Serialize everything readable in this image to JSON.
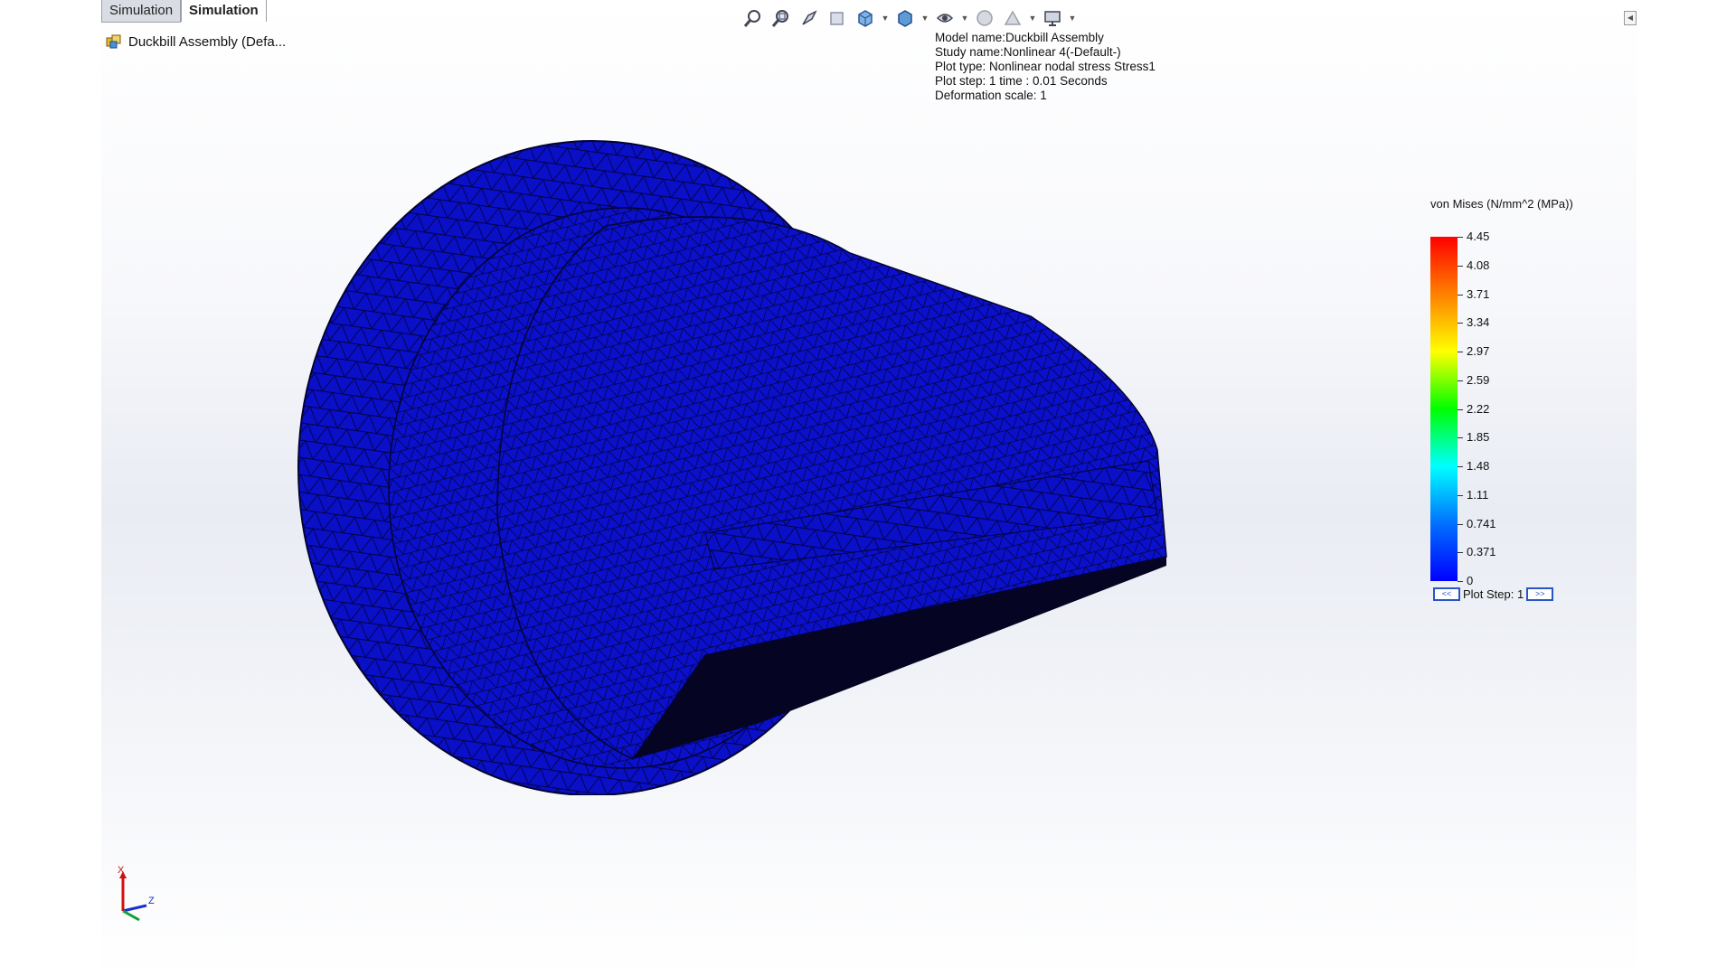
{
  "tabs": [
    {
      "label": "Simulation"
    },
    {
      "label": "Simulation"
    }
  ],
  "tree": {
    "assembly_label": "Duckbill Assembly  (Defa..."
  },
  "toolbar": {
    "icons": [
      "zoom-to-fit-icon",
      "zoom-area-icon",
      "previous-view-icon",
      "section-view-icon",
      "view-orientation-icon",
      "display-style-icon",
      "hide-show-icon",
      "edit-appearance-icon",
      "apply-scene-icon",
      "view-settings-icon"
    ]
  },
  "info": {
    "model_name": "Model name:Duckbill Assembly",
    "study_name": "Study name:Nonlinear 4(-Default-)",
    "plot_type": "Plot type: Nonlinear nodal stress Stress1",
    "plot_step": "Plot step: 1   time : 0.01 Seconds",
    "deformation_scale": "Deformation scale: 1"
  },
  "legend": {
    "title": "von Mises (N/mm^2 (MPa))",
    "ticks": [
      "4.45",
      "4.08",
      "3.71",
      "3.34",
      "2.97",
      "2.59",
      "2.22",
      "1.85",
      "1.48",
      "1.11",
      "0.741",
      "0.371",
      "0"
    ],
    "gradient_colors": [
      "#ff0000",
      "#ff8000",
      "#ffff00",
      "#00ff00",
      "#00ffff",
      "#0070ff",
      "#0000ff"
    ],
    "plot_step_label": "Plot Step: 1",
    "prev_label": "<<",
    "next_label": ">>"
  },
  "model": {
    "fill_color": "#0a0fc8",
    "shadow_color": "#050523"
  },
  "triad": {
    "x": "X",
    "z": "Z"
  }
}
